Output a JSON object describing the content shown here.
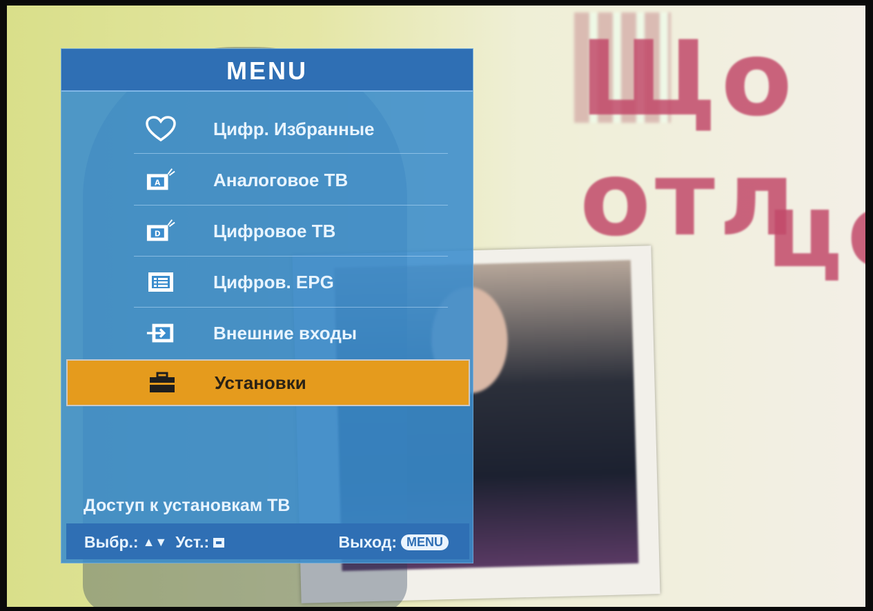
{
  "menu": {
    "title": "MENU",
    "items": [
      {
        "label": "Цифр. Избранные",
        "icon": "heart-icon"
      },
      {
        "label": "Аналоговое ТВ",
        "icon": "analog-tv-icon"
      },
      {
        "label": "Цифровое ТВ",
        "icon": "digital-tv-icon"
      },
      {
        "label": "Цифров. EPG",
        "icon": "epg-list-icon"
      },
      {
        "label": "Внешние входы",
        "icon": "input-source-icon"
      },
      {
        "label": "Установки",
        "icon": "toolbox-icon",
        "selected": true
      }
    ],
    "hint": "Доступ к установкам ТВ",
    "footer": {
      "select_label": "Выбр.:",
      "select_keys": "▲▼",
      "set_label": "Уст.:",
      "exit_label": "Выход:",
      "exit_key": "MENU"
    }
  },
  "background": {
    "text_line1": "Що отл",
    "text_line2": "цен"
  },
  "colors": {
    "menu_bg": "#3a8ccd",
    "title_bar": "#2f6fb4",
    "selected": "#e59b1d",
    "bg_text": "#c24a6a"
  }
}
